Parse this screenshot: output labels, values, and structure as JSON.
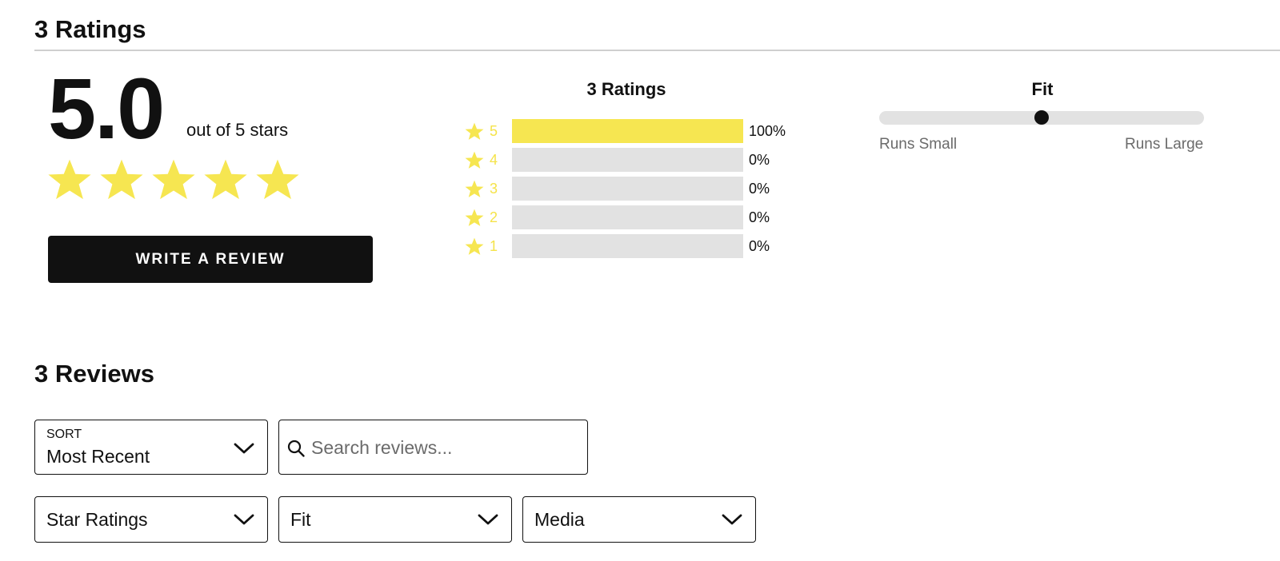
{
  "ratings_heading": "3 Ratings",
  "summary": {
    "score": "5.0",
    "out_of": "out of 5 stars",
    "stars_filled": 5,
    "stars_total": 5,
    "write_review_label": "WRITE A REVIEW"
  },
  "distribution": {
    "title": "3 Ratings",
    "rows": [
      {
        "star": "5",
        "percent": 100,
        "percent_label": "100%"
      },
      {
        "star": "4",
        "percent": 0,
        "percent_label": "0%"
      },
      {
        "star": "3",
        "percent": 0,
        "percent_label": "0%"
      },
      {
        "star": "2",
        "percent": 0,
        "percent_label": "0%"
      },
      {
        "star": "1",
        "percent": 0,
        "percent_label": "0%"
      }
    ]
  },
  "fit": {
    "title": "Fit",
    "value": 0.5,
    "min_label": "Runs Small",
    "max_label": "Runs Large"
  },
  "reviews_heading": "3 Reviews",
  "sort": {
    "caption": "SORT",
    "value": "Most Recent"
  },
  "search": {
    "placeholder": "Search reviews..."
  },
  "filters": {
    "star_ratings": "Star Ratings",
    "fit": "Fit",
    "media": "Media"
  },
  "colors": {
    "accent_yellow": "#f6e651",
    "bar_empty": "#e2e2e2",
    "button_dark": "#111111"
  },
  "icons": {
    "star": "star-icon",
    "chevron": "chevron-down-icon",
    "search": "search-icon"
  }
}
